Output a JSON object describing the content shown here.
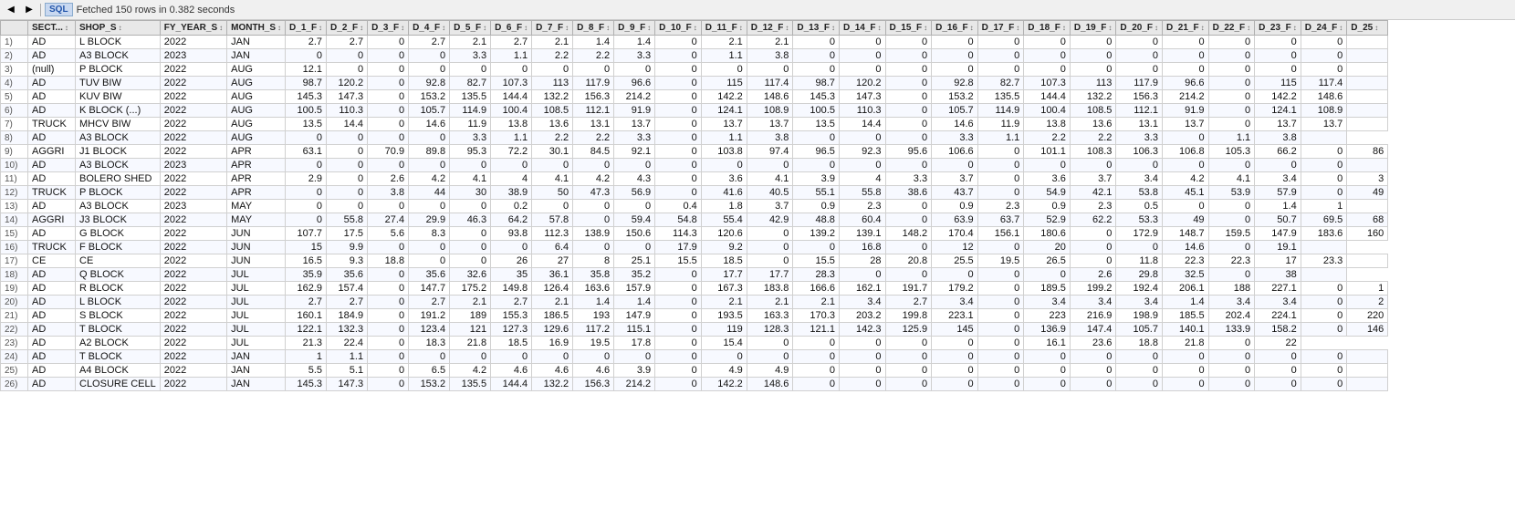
{
  "toolbar": {
    "status_text": "Fetched 150 rows in 0.382 seconds",
    "sql_label": "SQL"
  },
  "table": {
    "columns": [
      "",
      "SECT...",
      "SHOP_S",
      "FY_YEAR_S",
      "MONTH_S",
      "D_1_F",
      "D_2_F",
      "D_3_F",
      "D_4_F",
      "D_5_F",
      "D_6_F",
      "D_7_F",
      "D_8_F",
      "D_9_F",
      "D_10_F",
      "D_11_F",
      "D_12_F",
      "D_13_F",
      "D_14_F",
      "D_15_F",
      "D_16_F",
      "D_17_F",
      "D_18_F",
      "D_19_F",
      "D_20_F",
      "D_21_F",
      "D_22_F",
      "D_23_F",
      "D_24_F",
      "D_25"
    ],
    "rows": [
      [
        "1)",
        "AD",
        "L BLOCK",
        "2022",
        "JAN",
        "2.7",
        "2.7",
        "0",
        "2.7",
        "2.1",
        "2.7",
        "2.1",
        "1.4",
        "1.4",
        "0",
        "2.1",
        "2.1",
        "0",
        "0",
        "0",
        "0",
        "0",
        "0",
        "0",
        "0",
        "0",
        "0",
        "0",
        "0",
        ""
      ],
      [
        "2)",
        "AD",
        "A3 BLOCK",
        "2023",
        "JAN",
        "0",
        "0",
        "0",
        "0",
        "3.3",
        "1.1",
        "2.2",
        "2.2",
        "3.3",
        "0",
        "1.1",
        "3.8",
        "0",
        "0",
        "0",
        "0",
        "0",
        "0",
        "0",
        "0",
        "0",
        "0",
        "0",
        "0",
        ""
      ],
      [
        "3)",
        "(null)",
        "P BLOCK",
        "2022",
        "AUG",
        "12.1",
        "0",
        "0",
        "0",
        "0",
        "0",
        "0",
        "0",
        "0",
        "0",
        "0",
        "0",
        "0",
        "0",
        "0",
        "0",
        "0",
        "0",
        "0",
        "0",
        "0",
        "0",
        "0",
        "0",
        ""
      ],
      [
        "4)",
        "AD",
        "TUV BIW",
        "2022",
        "AUG",
        "98.7",
        "120.2",
        "0",
        "92.8",
        "82.7",
        "107.3",
        "113",
        "117.9",
        "96.6",
        "0",
        "115",
        "117.4",
        "98.7",
        "120.2",
        "0",
        "92.8",
        "82.7",
        "107.3",
        "113",
        "117.9",
        "96.6",
        "0",
        "115",
        "117.4",
        ""
      ],
      [
        "5)",
        "AD",
        "KUV BIW",
        "2022",
        "AUG",
        "145.3",
        "147.3",
        "0",
        "153.2",
        "135.5",
        "144.4",
        "132.2",
        "156.3",
        "214.2",
        "0",
        "142.2",
        "148.6",
        "145.3",
        "147.3",
        "0",
        "153.2",
        "135.5",
        "144.4",
        "132.2",
        "156.3",
        "214.2",
        "0",
        "142.2",
        "148.6",
        ""
      ],
      [
        "6)",
        "AD",
        "K BLOCK (...)",
        "2022",
        "AUG",
        "100.5",
        "110.3",
        "0",
        "105.7",
        "114.9",
        "100.4",
        "108.5",
        "112.1",
        "91.9",
        "0",
        "124.1",
        "108.9",
        "100.5",
        "110.3",
        "0",
        "105.7",
        "114.9",
        "100.4",
        "108.5",
        "112.1",
        "91.9",
        "0",
        "124.1",
        "108.9",
        ""
      ],
      [
        "7)",
        "TRUCK",
        "MHCV BIW",
        "2022",
        "AUG",
        "13.5",
        "14.4",
        "0",
        "14.6",
        "11.9",
        "13.8",
        "13.6",
        "13.1",
        "13.7",
        "0",
        "13.7",
        "13.7",
        "13.5",
        "14.4",
        "0",
        "14.6",
        "11.9",
        "13.8",
        "13.6",
        "13.1",
        "13.7",
        "0",
        "13.7",
        "13.7",
        ""
      ],
      [
        "8)",
        "AD",
        "A3 BLOCK",
        "2022",
        "AUG",
        "0",
        "0",
        "0",
        "0",
        "3.3",
        "1.1",
        "2.2",
        "2.2",
        "3.3",
        "0",
        "1.1",
        "3.8",
        "0",
        "0",
        "0",
        "3.3",
        "1.1",
        "2.2",
        "2.2",
        "3.3",
        "0",
        "1.1",
        "3.8",
        ""
      ],
      [
        "9)",
        "AGGRI",
        "J1 BLOCK",
        "2022",
        "APR",
        "63.1",
        "0",
        "70.9",
        "89.8",
        "95.3",
        "72.2",
        "30.1",
        "84.5",
        "92.1",
        "0",
        "103.8",
        "97.4",
        "96.5",
        "92.3",
        "95.6",
        "106.6",
        "0",
        "101.1",
        "108.3",
        "106.3",
        "106.8",
        "105.3",
        "66.2",
        "0",
        "86"
      ],
      [
        "10)",
        "AD",
        "A3 BLOCK",
        "2023",
        "APR",
        "0",
        "0",
        "0",
        "0",
        "0",
        "0",
        "0",
        "0",
        "0",
        "0",
        "0",
        "0",
        "0",
        "0",
        "0",
        "0",
        "0",
        "0",
        "0",
        "0",
        "0",
        "0",
        "0",
        "0",
        ""
      ],
      [
        "11)",
        "AD",
        "BOLERO SHED",
        "2022",
        "APR",
        "2.9",
        "0",
        "2.6",
        "4.2",
        "4.1",
        "4",
        "4.1",
        "4.2",
        "4.3",
        "0",
        "3.6",
        "4.1",
        "3.9",
        "4",
        "3.3",
        "3.7",
        "0",
        "3.6",
        "3.7",
        "3.4",
        "4.2",
        "4.1",
        "3.4",
        "0",
        "3"
      ],
      [
        "12)",
        "TRUCK",
        "P BLOCK",
        "2022",
        "APR",
        "0",
        "0",
        "3.8",
        "44",
        "30",
        "38.9",
        "50",
        "47.3",
        "56.9",
        "0",
        "41.6",
        "40.5",
        "55.1",
        "55.8",
        "38.6",
        "43.7",
        "0",
        "54.9",
        "42.1",
        "53.8",
        "45.1",
        "53.9",
        "57.9",
        "0",
        "49"
      ],
      [
        "13)",
        "AD",
        "A3 BLOCK",
        "2023",
        "MAY",
        "0",
        "0",
        "0",
        "0",
        "0",
        "0.2",
        "0",
        "0",
        "0",
        "0.4",
        "1.8",
        "3.7",
        "0.9",
        "2.3",
        "0",
        "0.9",
        "2.3",
        "0.9",
        "2.3",
        "0.5",
        "0",
        "0",
        "1.4",
        "1",
        ""
      ],
      [
        "14)",
        "AGGRI",
        "J3 BLOCK",
        "2022",
        "MAY",
        "0",
        "55.8",
        "27.4",
        "29.9",
        "46.3",
        "64.2",
        "57.8",
        "0",
        "59.4",
        "54.8",
        "55.4",
        "42.9",
        "48.8",
        "60.4",
        "0",
        "63.9",
        "63.7",
        "52.9",
        "62.2",
        "53.3",
        "49",
        "0",
        "50.7",
        "69.5",
        "68"
      ],
      [
        "15)",
        "AD",
        "G BLOCK",
        "2022",
        "JUN",
        "107.7",
        "17.5",
        "5.6",
        "8.3",
        "0",
        "93.8",
        "112.3",
        "138.9",
        "150.6",
        "114.3",
        "120.6",
        "0",
        "139.2",
        "139.1",
        "148.2",
        "170.4",
        "156.1",
        "180.6",
        "0",
        "172.9",
        "148.7",
        "159.5",
        "147.9",
        "183.6",
        "160"
      ],
      [
        "16)",
        "TRUCK",
        "F BLOCK",
        "2022",
        "JUN",
        "15",
        "9.9",
        "0",
        "0",
        "0",
        "0",
        "6.4",
        "0",
        "0",
        "17.9",
        "9.2",
        "0",
        "0",
        "16.8",
        "0",
        "12",
        "0",
        "20",
        "0",
        "0",
        "14.6",
        "0",
        "19.1",
        ""
      ],
      [
        "17)",
        "CE",
        "CE",
        "2022",
        "JUN",
        "16.5",
        "9.3",
        "18.8",
        "0",
        "0",
        "26",
        "27",
        "8",
        "25.1",
        "15.5",
        "18.5",
        "0",
        "15.5",
        "28",
        "20.8",
        "25.5",
        "19.5",
        "26.5",
        "0",
        "11.8",
        "22.3",
        "22.3",
        "17",
        "23.3",
        ""
      ],
      [
        "18)",
        "AD",
        "Q BLOCK",
        "2022",
        "JUL",
        "35.9",
        "35.6",
        "0",
        "35.6",
        "32.6",
        "35",
        "36.1",
        "35.8",
        "35.2",
        "0",
        "17.7",
        "17.7",
        "28.3",
        "0",
        "0",
        "0",
        "0",
        "0",
        "2.6",
        "29.8",
        "32.5",
        "0",
        "38",
        ""
      ],
      [
        "19)",
        "AD",
        "R BLOCK",
        "2022",
        "JUL",
        "162.9",
        "157.4",
        "0",
        "147.7",
        "175.2",
        "149.8",
        "126.4",
        "163.6",
        "157.9",
        "0",
        "167.3",
        "183.8",
        "166.6",
        "162.1",
        "191.7",
        "179.2",
        "0",
        "189.5",
        "199.2",
        "192.4",
        "206.1",
        "188",
        "227.1",
        "0",
        "1"
      ],
      [
        "20)",
        "AD",
        "L BLOCK",
        "2022",
        "JUL",
        "2.7",
        "2.7",
        "0",
        "2.7",
        "2.1",
        "2.7",
        "2.1",
        "1.4",
        "1.4",
        "0",
        "2.1",
        "2.1",
        "2.1",
        "3.4",
        "2.7",
        "3.4",
        "0",
        "3.4",
        "3.4",
        "3.4",
        "1.4",
        "3.4",
        "3.4",
        "0",
        "2"
      ],
      [
        "21)",
        "AD",
        "S BLOCK",
        "2022",
        "JUL",
        "160.1",
        "184.9",
        "0",
        "191.2",
        "189",
        "155.3",
        "186.5",
        "193",
        "147.9",
        "0",
        "193.5",
        "163.3",
        "170.3",
        "203.2",
        "199.8",
        "223.1",
        "0",
        "223",
        "216.9",
        "198.9",
        "185.5",
        "202.4",
        "224.1",
        "0",
        "220"
      ],
      [
        "22)",
        "AD",
        "T BLOCK",
        "2022",
        "JUL",
        "122.1",
        "132.3",
        "0",
        "123.4",
        "121",
        "127.3",
        "129.6",
        "117.2",
        "115.1",
        "0",
        "119",
        "128.3",
        "121.1",
        "142.3",
        "125.9",
        "145",
        "0",
        "136.9",
        "147.4",
        "105.7",
        "140.1",
        "133.9",
        "158.2",
        "0",
        "146"
      ],
      [
        "23)",
        "AD",
        "A2 BLOCK",
        "2022",
        "JUL",
        "21.3",
        "22.4",
        "0",
        "18.3",
        "21.8",
        "18.5",
        "16.9",
        "19.5",
        "17.8",
        "0",
        "15.4",
        "0",
        "0",
        "0",
        "0",
        "0",
        "0",
        "16.1",
        "23.6",
        "18.8",
        "21.8",
        "0",
        "22"
      ],
      [
        "24)",
        "AD",
        "T BLOCK",
        "2022",
        "JAN",
        "1",
        "1.1",
        "0",
        "0",
        "0",
        "0",
        "0",
        "0",
        "0",
        "0",
        "0",
        "0",
        "0",
        "0",
        "0",
        "0",
        "0",
        "0",
        "0",
        "0",
        "0",
        "0",
        "0",
        "0",
        ""
      ],
      [
        "25)",
        "AD",
        "A4 BLOCK",
        "2022",
        "JAN",
        "5.5",
        "5.1",
        "0",
        "6.5",
        "4.2",
        "4.6",
        "4.6",
        "4.6",
        "3.9",
        "0",
        "4.9",
        "4.9",
        "0",
        "0",
        "0",
        "0",
        "0",
        "0",
        "0",
        "0",
        "0",
        "0",
        "0",
        "0",
        ""
      ],
      [
        "26)",
        "AD",
        "CLOSURE CELL",
        "2022",
        "JAN",
        "145.3",
        "147.3",
        "0",
        "153.2",
        "135.5",
        "144.4",
        "132.2",
        "156.3",
        "214.2",
        "0",
        "142.2",
        "148.6",
        "0",
        "0",
        "0",
        "0",
        "0",
        "0",
        "0",
        "0",
        "0",
        "0",
        "0",
        "0",
        ""
      ]
    ]
  }
}
